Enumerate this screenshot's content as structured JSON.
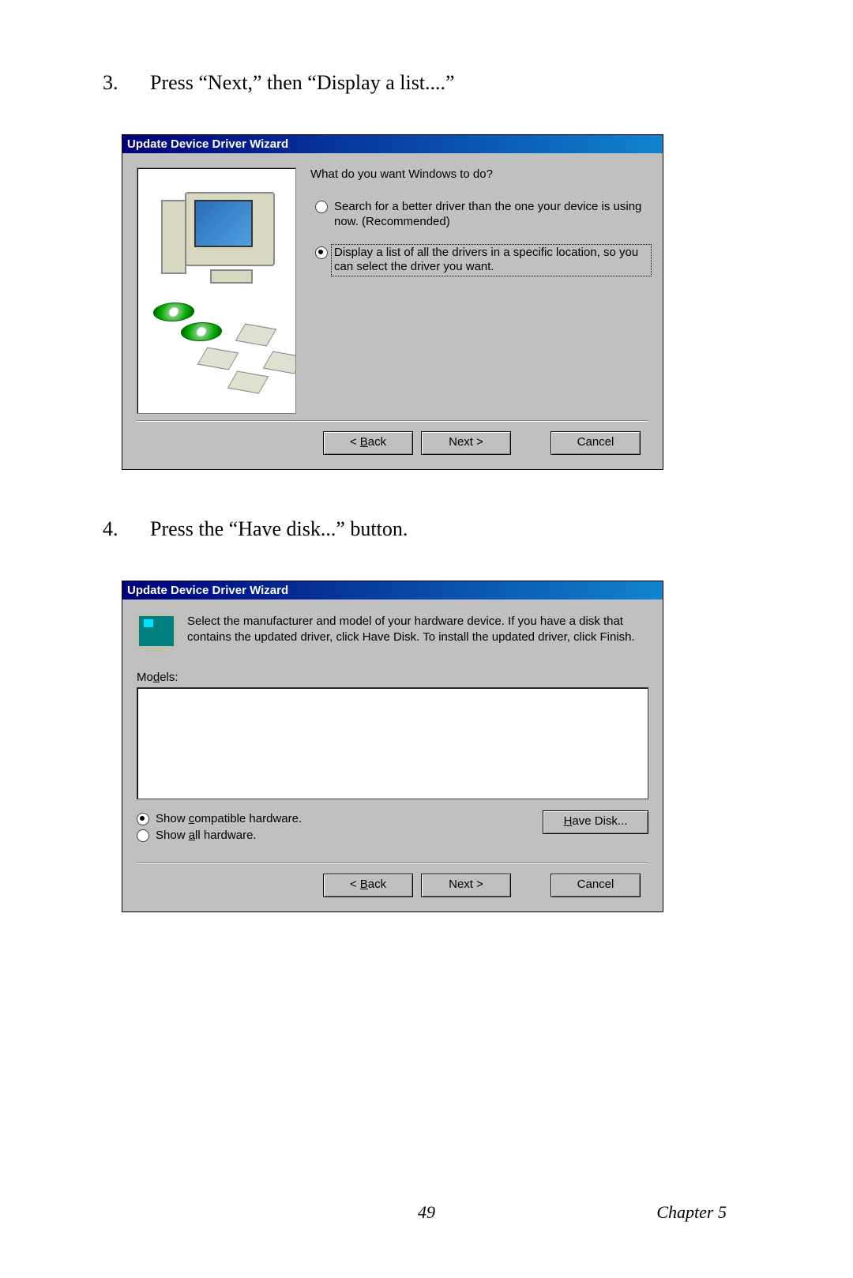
{
  "step3": {
    "number": "3.",
    "text": "Press “Next,” then “Display a list....”"
  },
  "step4": {
    "number": "4.",
    "text": "Press the “Have disk...” button."
  },
  "dialog1": {
    "title": "Update Device Driver Wizard",
    "prompt": "What do you want Windows to do?",
    "option1": "Search for a better driver than the one your device is using now. (Recommended)",
    "option2": "Display a list of all the drivers in a specific location, so you can select the driver you want.",
    "back_pre": "< ",
    "back_u": "B",
    "back_post": "ack",
    "next": "Next >",
    "cancel": "Cancel"
  },
  "dialog2": {
    "title": "Update Device Driver Wizard",
    "desc": "Select the manufacturer and model of your hardware device. If you have a disk that contains the updated driver, click Have Disk. To install the updated driver, click Finish.",
    "models_pre": "Mo",
    "models_u": "d",
    "models_post": "els:",
    "show_compat_pre": "Show ",
    "show_compat_u": "c",
    "show_compat_post": "ompatible hardware.",
    "show_all_pre": "Show ",
    "show_all_u": "a",
    "show_all_post": "ll hardware.",
    "have_disk_u": "H",
    "have_disk_post": "ave Disk...",
    "back_pre": "< ",
    "back_u": "B",
    "back_post": "ack",
    "next": "Next >",
    "cancel": "Cancel"
  },
  "footer": {
    "page": "49",
    "chapter": "Chapter 5"
  }
}
